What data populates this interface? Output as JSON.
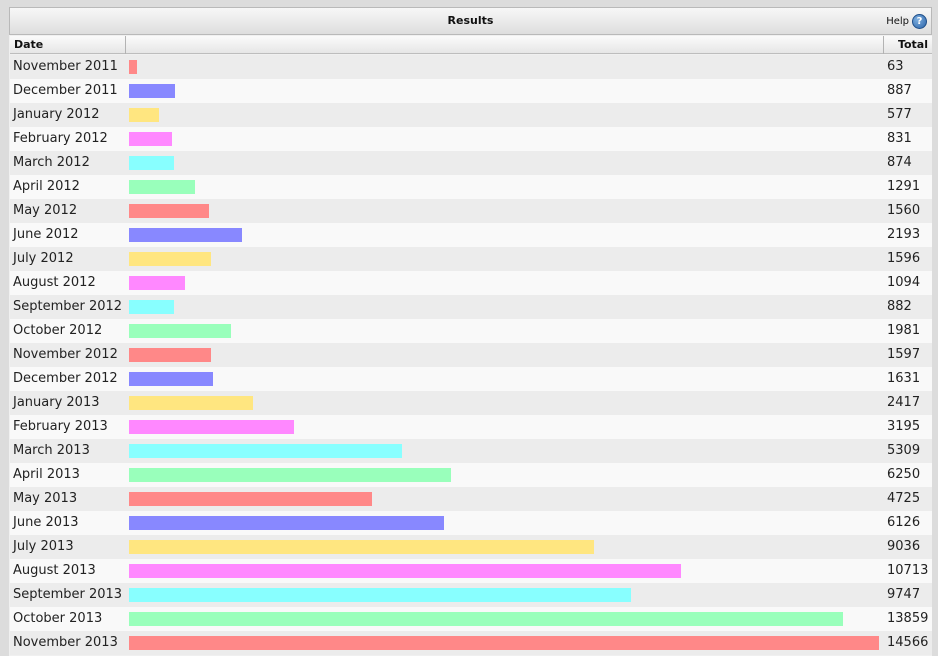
{
  "panel": {
    "title": "Results",
    "help_label": "Help",
    "help_icon": "help-icon"
  },
  "table": {
    "headers": {
      "date": "Date",
      "bar": "",
      "total": "Total"
    }
  },
  "chart_data": {
    "type": "bar",
    "orientation": "horizontal",
    "colors": [
      "#ff8888",
      "#8888ff",
      "#ffe680",
      "#ff88ff",
      "#88ffff",
      "#99ffbb"
    ],
    "categories": [
      "November 2011",
      "December 2011",
      "January 2012",
      "February 2012",
      "March 2012",
      "April 2012",
      "May 2012",
      "June 2012",
      "July 2012",
      "August 2012",
      "September 2012",
      "October 2012",
      "November 2012",
      "December 2012",
      "January 2013",
      "February 2013",
      "March 2013",
      "April 2013",
      "May 2013",
      "June 2013",
      "July 2013",
      "August 2013",
      "September 2013",
      "October 2013",
      "November 2013"
    ],
    "values": [
      63,
      887,
      577,
      831,
      874,
      1291,
      1560,
      2193,
      1596,
      1094,
      882,
      1981,
      1597,
      1631,
      2417,
      3195,
      5309,
      6250,
      4725,
      6126,
      9036,
      10713,
      9747,
      13859,
      14566
    ],
    "max": 14566
  }
}
